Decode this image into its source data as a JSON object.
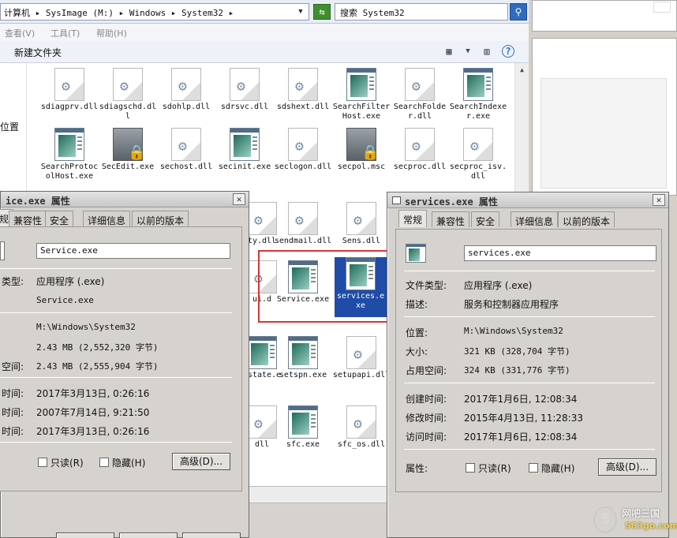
{
  "explorer": {
    "address_path": "计算机 ▸ SysImage (M:) ▸ Windows ▸ System32 ▸",
    "search_placeholder": "搜索 System32",
    "menu": [
      "查看(V)",
      "工具(T)",
      "帮助(H)"
    ],
    "new_folder": "新建文件夹",
    "nav_label": "位置",
    "files_row1": [
      {
        "name": "sdiagprv.dll",
        "type": "dll"
      },
      {
        "name": "sdiagschd.dll",
        "type": "dll"
      },
      {
        "name": "sdohlp.dll",
        "type": "dll"
      },
      {
        "name": "sdrsvc.dll",
        "type": "dll"
      },
      {
        "name": "sdshext.dll",
        "type": "dll"
      },
      {
        "name": "SearchFilterHost.exe",
        "type": "exe"
      },
      {
        "name": "SearchFolder.dll",
        "type": "dll"
      },
      {
        "name": "SearchIndexer.exe",
        "type": "exe"
      }
    ],
    "files_row2": [
      {
        "name": "SearchProtocolHost.exe",
        "type": "exe"
      },
      {
        "name": "SecEdit.exe",
        "type": "srv"
      },
      {
        "name": "sechost.dll",
        "type": "dll"
      },
      {
        "name": "secinit.exe",
        "type": "exe"
      },
      {
        "name": "seclogon.dll",
        "type": "dll"
      },
      {
        "name": "secpol.msc",
        "type": "srv"
      },
      {
        "name": "secproc.dll",
        "type": "dll"
      },
      {
        "name": "secproc_isv.dll",
        "type": "dll"
      }
    ],
    "files_row3": [
      {
        "name": "ty.dll",
        "type": "dll"
      },
      {
        "name": "sendmail.dll",
        "type": "dll"
      },
      {
        "name": "Sens.dll",
        "type": "dll"
      }
    ],
    "files_row4": [
      {
        "name": "ui.d",
        "type": "dll"
      },
      {
        "name": "Service.exe",
        "type": "exe"
      },
      {
        "name": "services.exe",
        "type": "exe"
      }
    ],
    "files_row5": [
      {
        "name": "nstate.e",
        "type": "exe"
      },
      {
        "name": "setspn.exe",
        "type": "exe"
      },
      {
        "name": "setupapi.dll",
        "type": "dll"
      }
    ],
    "files_row6": [
      {
        "name": "dll",
        "type": "dll"
      },
      {
        "name": "sfc.exe",
        "type": "exe"
      },
      {
        "name": "sfc_os.dll",
        "type": "dll"
      }
    ]
  },
  "dialog_left": {
    "title": "ice.exe 属性",
    "tabs": [
      "规",
      "兼容性",
      "安全",
      "详细信息",
      "以前的版本"
    ],
    "filename": "Service.exe",
    "file_type_label": "类型:",
    "file_type_value": "应用程序 (.exe)",
    "description_value": "Service.exe",
    "location_value": "M:\\Windows\\System32",
    "size_value": "2.43 MB (2,552,320 字节)",
    "size_on_disk_label": "空间:",
    "size_on_disk_value": "2.43 MB (2,555,904 字节)",
    "created_label": "时间:",
    "created_value": "2017年3月13日, 0:26:16",
    "modified_label": "时间:",
    "modified_value": "2007年7月14日, 9:21:50",
    "accessed_label": "时间:",
    "accessed_value": "2017年3月13日, 0:26:16",
    "readonly_label": "只读(R)",
    "hidden_label": "隐藏(H)",
    "advanced_button": "高级(D)..."
  },
  "dialog_right": {
    "title": "services.exe 属性",
    "tabs": [
      "常规",
      "兼容性",
      "安全",
      "详细信息",
      "以前的版本"
    ],
    "filename": "services.exe",
    "file_type_label": "文件类型:",
    "file_type_value": "应用程序 (.exe)",
    "description_label": "描述:",
    "description_value": "服务和控制器应用程序",
    "location_label": "位置:",
    "location_value": "M:\\Windows\\System32",
    "size_label": "大小:",
    "size_value": "321 KB (328,704 字节)",
    "size_on_disk_label": "占用空间:",
    "size_on_disk_value": "324 KB (331,776 字节)",
    "created_label": "创建时间:",
    "created_value": "2017年1月6日, 12:08:34",
    "modified_label": "修改时间:",
    "modified_value": "2015年4月13日, 11:28:33",
    "accessed_label": "访问时间:",
    "accessed_value": "2017年1月6日, 12:08:34",
    "attributes_label": "属性:",
    "readonly_label": "只读(R)",
    "hidden_label": "隐藏(H)",
    "advanced_button": "高级(D)..."
  },
  "watermark": {
    "logo_text": "5",
    "site_name": "网吧三国",
    "site_url": "583go.com"
  }
}
